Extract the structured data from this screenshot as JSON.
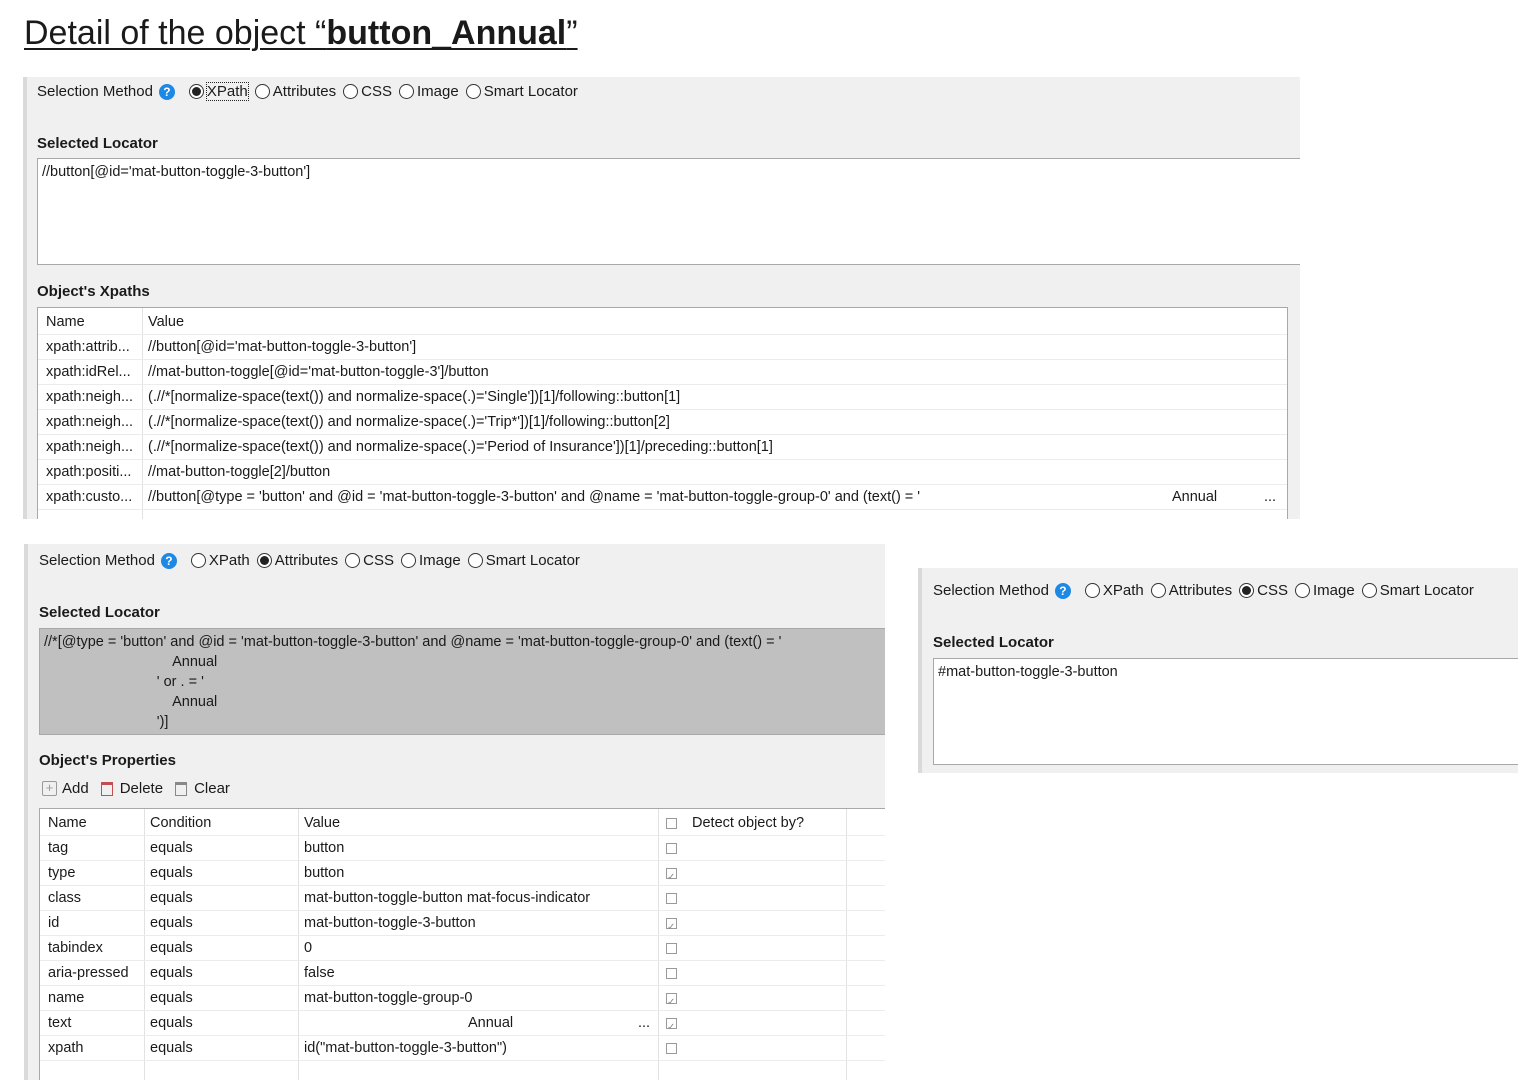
{
  "page": {
    "title_prefix": "Detail of the object “",
    "title_bold": "button_Annual",
    "title_suffix": "”"
  },
  "panel1": {
    "selection_label": "Selection Method",
    "options": [
      "XPath",
      "Attributes",
      "CSS",
      "Image",
      "Smart Locator"
    ],
    "selected": "XPath",
    "selected_locator_label": "Selected Locator",
    "selected_locator": "//button[@id='mat-button-toggle-3-button']",
    "xpaths_label": "Object's Xpaths",
    "columns": [
      "Name",
      "Value"
    ],
    "rows": [
      {
        "name": "xpath:attrib...",
        "value": "//button[@id='mat-button-toggle-3-button']"
      },
      {
        "name": "xpath:idRel...",
        "value": "//mat-button-toggle[@id='mat-button-toggle-3']/button"
      },
      {
        "name": "xpath:neigh...",
        "value": "(.//*[normalize-space(text()) and normalize-space(.)='Single'])[1]/following::button[1]"
      },
      {
        "name": "xpath:neigh...",
        "value": "(.//*[normalize-space(text()) and normalize-space(.)='Trip*'])[1]/following::button[2]"
      },
      {
        "name": "xpath:neigh...",
        "value": "(.//*[normalize-space(text()) and normalize-space(.)='Period of Insurance'])[1]/preceding::button[1]"
      },
      {
        "name": "xpath:positi...",
        "value": "//mat-button-toggle[2]/button"
      },
      {
        "name": "xpath:custo...",
        "value": "//button[@type = 'button' and @id = 'mat-button-toggle-3-button' and @name = 'mat-button-toggle-group-0' and (text() = '",
        "extra": "Annual",
        "more": "..."
      }
    ]
  },
  "panel2": {
    "selection_label": "Selection Method",
    "options": [
      "XPath",
      "Attributes",
      "CSS",
      "Image",
      "Smart Locator"
    ],
    "selected": "Attributes",
    "selected_locator_label": "Selected Locator",
    "selected_locator": "//*[@type = 'button' and @id = 'mat-button-toggle-3-button' and @name = 'mat-button-toggle-group-0' and (text() = '\n                                Annual\n                            ' or . = '\n                                Annual\n                            ')]",
    "properties_label": "Object's Properties",
    "toolbar": {
      "add": "Add",
      "delete": "Delete",
      "clear": "Clear"
    },
    "columns": [
      "Name",
      "Condition",
      "Value",
      "Detect object by?"
    ],
    "rows": [
      {
        "name": "tag",
        "condition": "equals",
        "value": "button",
        "detect": false
      },
      {
        "name": "type",
        "condition": "equals",
        "value": "button",
        "detect": true
      },
      {
        "name": "class",
        "condition": "equals",
        "value": "mat-button-toggle-button mat-focus-indicator",
        "detect": false
      },
      {
        "name": "id",
        "condition": "equals",
        "value": "mat-button-toggle-3-button",
        "detect": true
      },
      {
        "name": "tabindex",
        "condition": "equals",
        "value": "0",
        "detect": false
      },
      {
        "name": "aria-pressed",
        "condition": "equals",
        "value": "false",
        "detect": false
      },
      {
        "name": "name",
        "condition": "equals",
        "value": "mat-button-toggle-group-0",
        "detect": true
      },
      {
        "name": "text",
        "condition": "equals",
        "value": "Annual",
        "more": "...",
        "detect": true
      },
      {
        "name": "xpath",
        "condition": "equals",
        "value": "id(\"mat-button-toggle-3-button\")",
        "detect": false
      }
    ]
  },
  "panel3": {
    "selection_label": "Selection Method",
    "options": [
      "XPath",
      "Attributes",
      "CSS",
      "Image",
      "Smart Locator"
    ],
    "selected": "CSS",
    "selected_locator_label": "Selected Locator",
    "selected_locator": "#mat-button-toggle-3-button"
  }
}
